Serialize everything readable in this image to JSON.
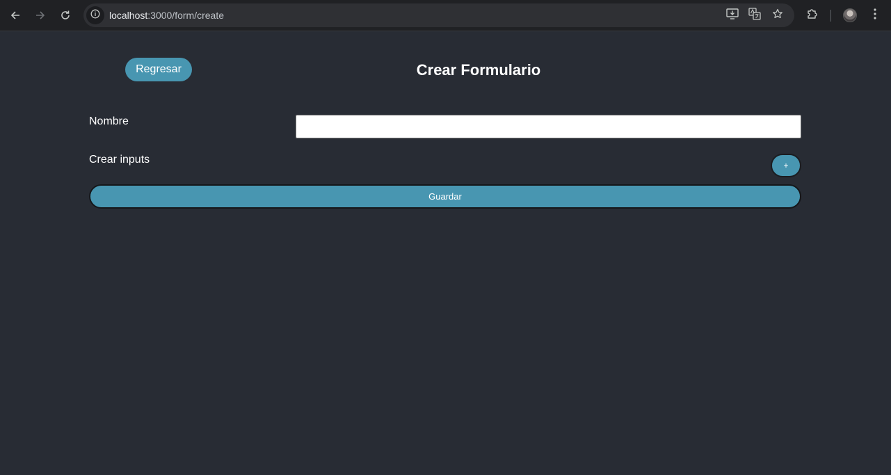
{
  "browser": {
    "url_host": "localhost",
    "url_path": ":3000/form/create"
  },
  "page": {
    "back_label": "Regresar",
    "title": "Crear Formulario",
    "name_label": "Nombre",
    "name_value": "",
    "inputs_label": "Crear inputs",
    "add_label": "+",
    "save_label": "Guardar"
  },
  "colors": {
    "background": "#282c34",
    "accent": "#4896b1",
    "chrome": "#202124"
  },
  "icons": {
    "back": "arrow-left-icon",
    "forward": "arrow-right-icon",
    "reload": "reload-icon",
    "site_info": "info-icon",
    "install": "install-app-icon",
    "translate": "translate-icon",
    "bookmark": "star-icon",
    "extensions": "puzzle-icon",
    "menu": "kebab-menu-icon"
  }
}
